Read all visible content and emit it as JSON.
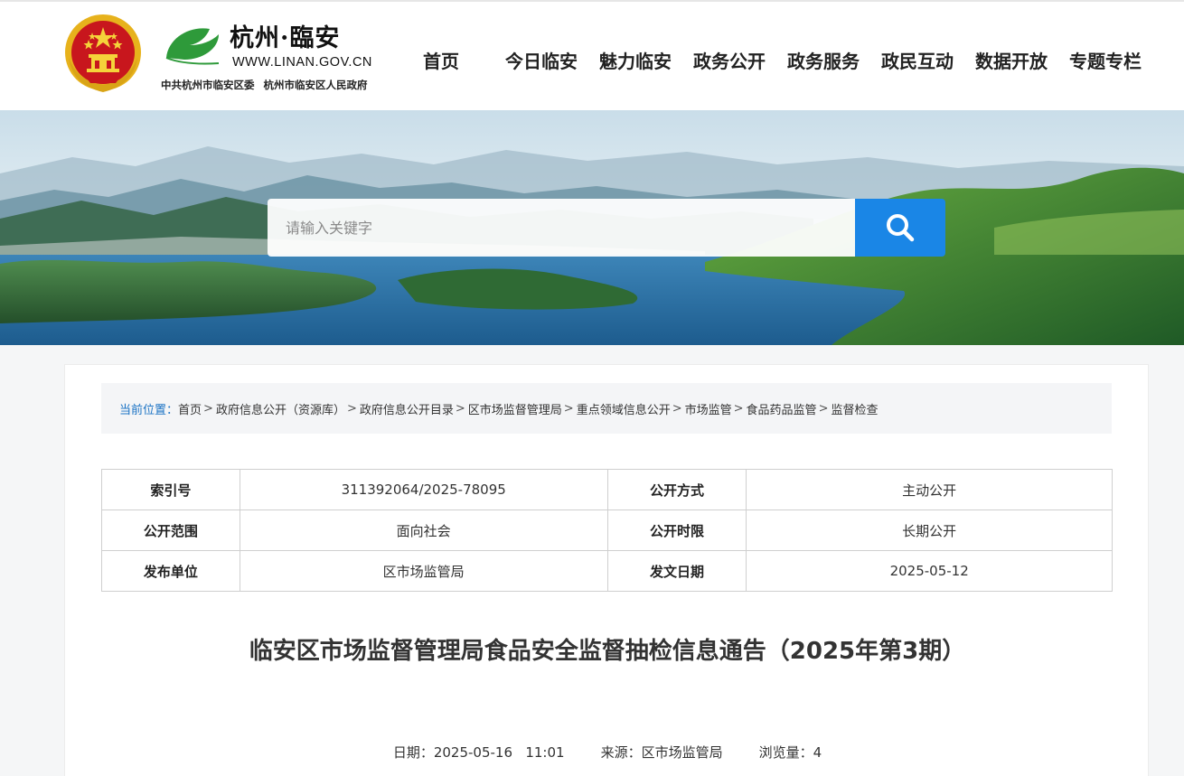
{
  "header": {
    "site_name": "杭州·臨安",
    "site_url": "WWW.LINAN.GOV.CN",
    "org_committee": "中共杭州市临安区委",
    "org_government": "杭州市临安区人民政府",
    "emblem_icon": "national-emblem-icon",
    "logo_icon": "ginkgo-leaf-icon"
  },
  "nav": {
    "items": [
      {
        "label": "首页"
      },
      {
        "label": "今日临安"
      },
      {
        "label": "魅力临安"
      },
      {
        "label": "政务公开"
      },
      {
        "label": "政务服务"
      },
      {
        "label": "政民互动"
      },
      {
        "label": "数据开放"
      },
      {
        "label": "专题专栏"
      }
    ]
  },
  "search": {
    "placeholder": "请输入关键字",
    "icon": "search-icon",
    "button_color": "#1a86e6"
  },
  "breadcrumb": {
    "lead": "当前位置：",
    "items": [
      {
        "label": "首页"
      },
      {
        "label": "政府信息公开（资源库）"
      },
      {
        "label": "政府信息公开目录"
      },
      {
        "label": "区市场监督管理局"
      },
      {
        "label": "重点领域信息公开"
      },
      {
        "label": "市场监管"
      },
      {
        "label": "食品药品监管"
      },
      {
        "label": "监督检查"
      }
    ]
  },
  "meta": {
    "index_no_label": "索引号",
    "index_no": "311392064/2025-78095",
    "open_mode_label": "公开方式",
    "open_mode": "主动公开",
    "scope_label": "公开范围",
    "scope": "面向社会",
    "period_label": "公开时限",
    "period": "长期公开",
    "publisher_label": "发布单位",
    "publisher": "区市场监管局",
    "issue_date_label": "发文日期",
    "issue_date": "2025-05-12"
  },
  "article": {
    "title": "临安区市场监督管理局食品安全监督抽检信息通告（2025年第3期）",
    "date_label": "日期：",
    "date": "2025-05-16   11:01",
    "source_label": "来源：",
    "source": "区市场监管局",
    "views_label": "浏览量：",
    "views": "4"
  },
  "colors": {
    "accent_link": "#1a72c4",
    "breadcrumb_bg": "#f4f5f7"
  }
}
